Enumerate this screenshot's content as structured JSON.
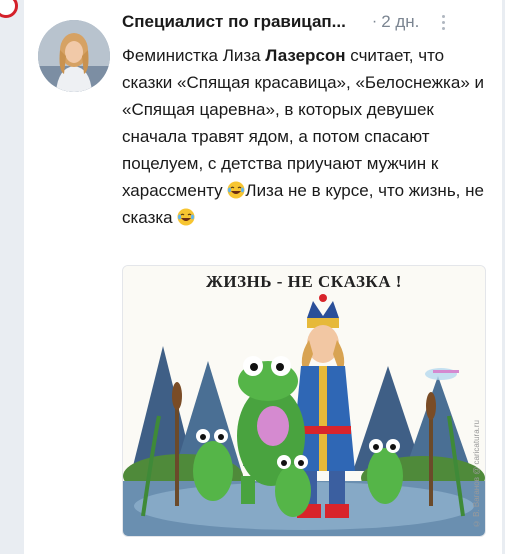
{
  "post": {
    "author": "Специалист по гравицап...",
    "dot": "·",
    "age": "2 дн.",
    "text": {
      "part1": "Феминистка Лиза ",
      "name_bold": "Лазерсон",
      "part2": " считает, что сказки «Спящая красавица», «Белоснежка» и «Спящая царевна», в которых девушек сначала травят ядом, а потом спасают поцелуем, с детства приучают мужчин к харассменту ",
      "part3": "Лиза не в курсе, что жизнь, не сказка ",
      "emoji": "laughing-tears-emoji"
    }
  },
  "image": {
    "caption": "ЖИЗНЬ - НЕ СКАЗКА !",
    "watermark": "© В. Ваганов @ caricatura.ru"
  },
  "colors": {
    "page_bg": "#e9edf2",
    "card_bg": "#ffffff",
    "text": "#1a1a1a",
    "muted": "#7b8591"
  }
}
